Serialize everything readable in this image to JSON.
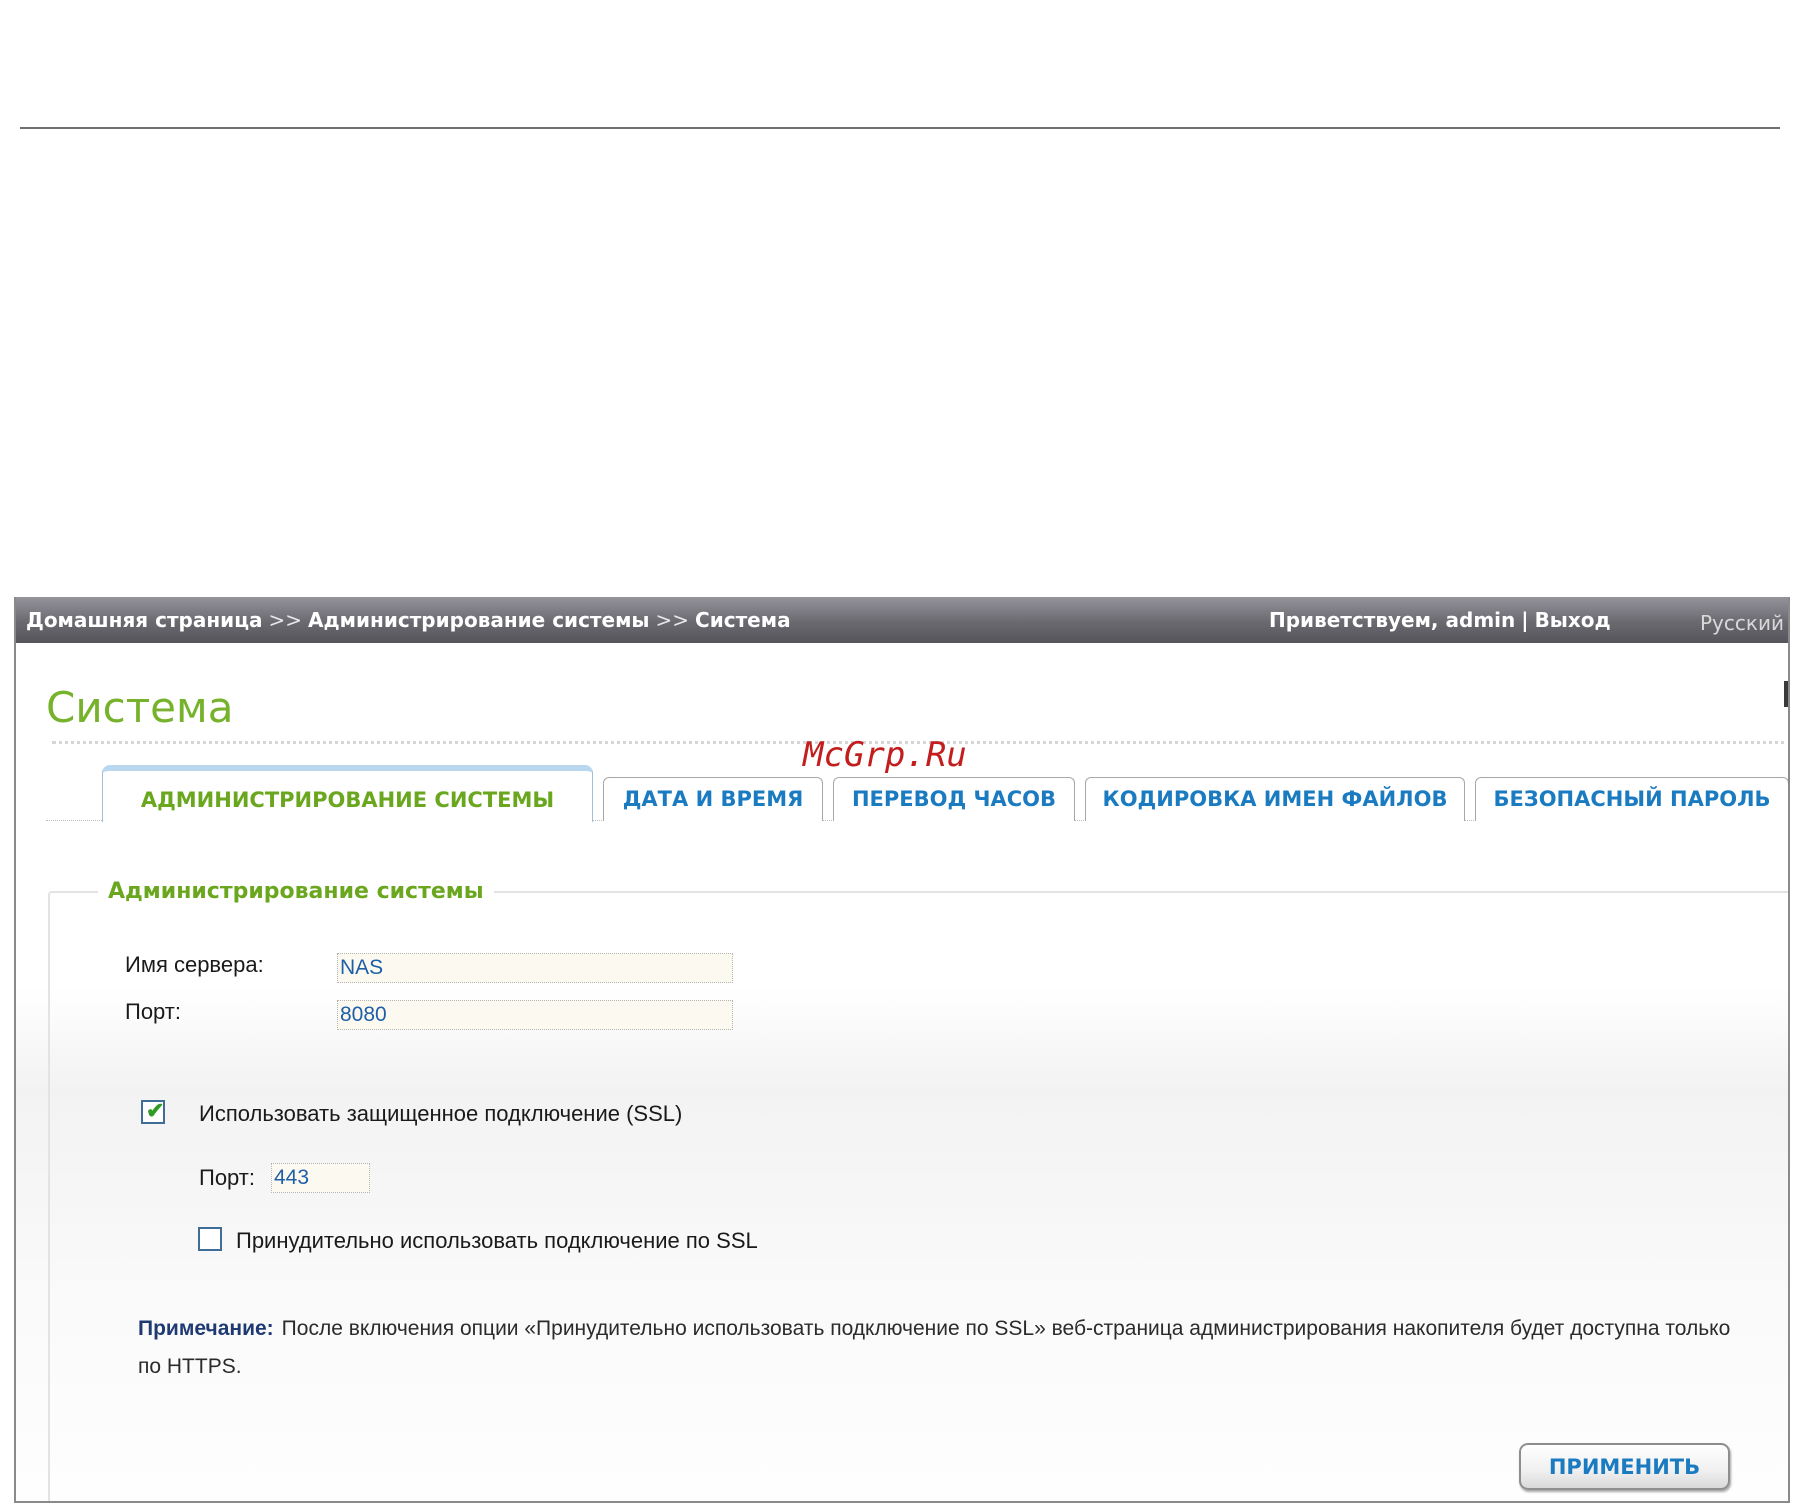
{
  "topbar": {
    "crumb_home": "Домашняя страница",
    "crumb_sep": ">>",
    "crumb_admin": "Администрирование системы",
    "crumb_current": "Система",
    "greeting": "Приветствуем,",
    "user": "admin",
    "pipe": "|",
    "logout": "Выход",
    "language": "Русский"
  },
  "page": {
    "title": "Система"
  },
  "watermark": "McGrp.Ru",
  "tabs": [
    {
      "label": "АДМИНИСТРИРОВАНИЕ СИСТЕМЫ",
      "active": true
    },
    {
      "label": "ДАТА И ВРЕМЯ",
      "active": false
    },
    {
      "label": "ПЕРЕВОД ЧАСОВ",
      "active": false
    },
    {
      "label": "КОДИРОВКА ИМЕН ФАЙЛОВ",
      "active": false
    },
    {
      "label": "БЕЗОПАСНЫЙ ПАРОЛЬ",
      "active": false
    }
  ],
  "section": {
    "legend": "Администрирование системы",
    "server_name_label": "Имя сервера:",
    "server_name_value": "NAS",
    "port_label": "Порт:",
    "port_value": "8080",
    "ssl_label": "Использовать защищенное подключение (SSL)",
    "ssl_checked": true,
    "ssl_port_label": "Порт:",
    "ssl_port_value": "443",
    "force_ssl_label": "Принудительно использовать подключение по SSL",
    "force_ssl_checked": false,
    "note_label": "Примечание:",
    "note_text": "После включения опции «Принудительно использовать подключение по SSL» веб-страница администрирования накопителя будет доступна только по HTTPS."
  },
  "actions": {
    "apply_label": "ПРИМЕНИТЬ"
  },
  "colors": {
    "accent_green": "#76b22b",
    "link_blue": "#1b7bc1",
    "topbar_gray": "#6b6970",
    "note_blue": "#1f3a73"
  }
}
